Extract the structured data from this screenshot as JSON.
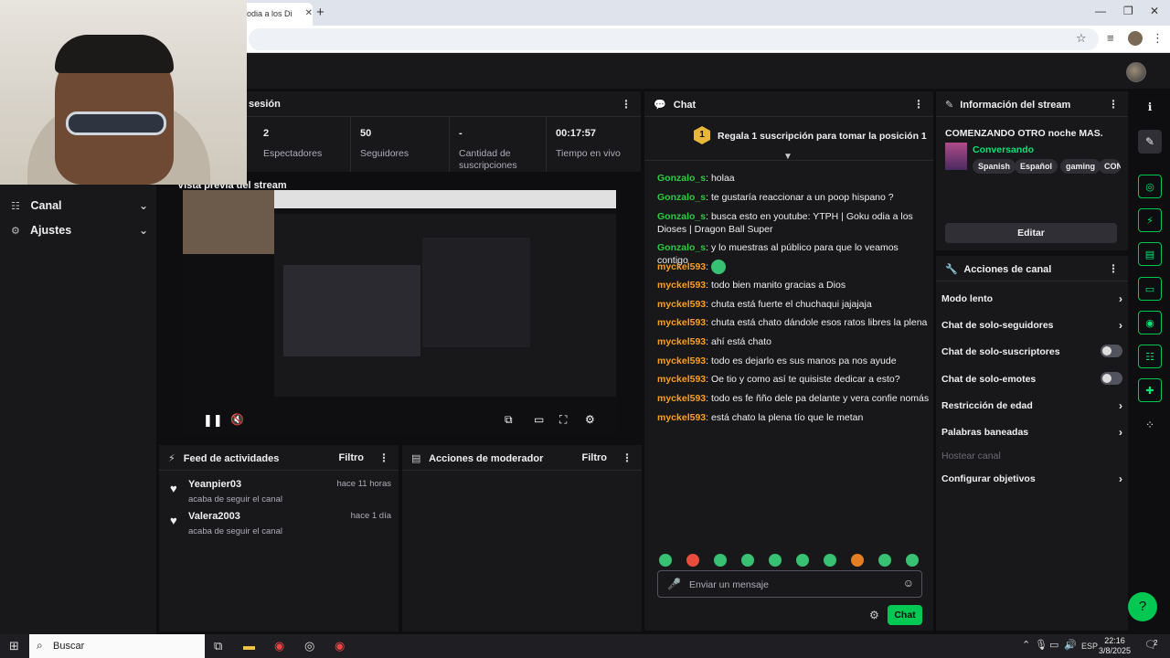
{
  "browser": {
    "tab_title": "odia a los Di",
    "new_tab": "+",
    "win_min": "—",
    "win_max": "❐",
    "win_close": "✕"
  },
  "sidebar": {
    "items": [
      {
        "label": "Canal"
      },
      {
        "label": "Ajustes"
      }
    ]
  },
  "session": {
    "title": "sesión",
    "stats": [
      {
        "value": "2",
        "label": "Espectadores"
      },
      {
        "value": "50",
        "label": "Seguidores"
      },
      {
        "value": "-",
        "label": "Cantidad de suscripciones"
      },
      {
        "value": "00:17:57",
        "label": "Tiempo en vivo"
      }
    ]
  },
  "preview": {
    "title": "Vista previa del stream"
  },
  "activity": {
    "title": "Feed de actividades",
    "filter": "Filtro",
    "items": [
      {
        "name": "Yeanpier03",
        "sub": "acaba de seguir el canal",
        "time": "hace 11 horas"
      },
      {
        "name": "Valera2003",
        "sub": "acaba de seguir el canal",
        "time": "hace 1 día"
      }
    ]
  },
  "modactions": {
    "title": "Acciones de moderador",
    "filter": "Filtro"
  },
  "chat": {
    "title": "Chat",
    "promo_badge": "1",
    "promo_text": "Regala 1 suscripción para tomar la posición 1",
    "messages": [
      {
        "user": "Gonzalo_s",
        "color": "#2ecc40",
        "text": "holaa"
      },
      {
        "user": "Gonzalo_s",
        "color": "#2ecc40",
        "text": "te gustaría reaccionar a un poop hispano ?"
      },
      {
        "user": "Gonzalo_s",
        "color": "#2ecc40",
        "text": "busca esto en youtube: YTPH | Goku odia a los Dioses | Dragon Ball Super"
      },
      {
        "user": "Gonzalo_s",
        "color": "#2ecc40",
        "text": "y lo muestras al público para que lo veamos contigo"
      },
      {
        "user": "myckel593",
        "color": "#ff9f1a",
        "text": ""
      },
      {
        "user": "myckel593",
        "color": "#ff9f1a",
        "text": "todo bien manito gracias a Dios"
      },
      {
        "user": "myckel593",
        "color": "#ff9f1a",
        "text": "chuta está fuerte el chuchaqui jajajaja"
      },
      {
        "user": "myckel593",
        "color": "#ff9f1a",
        "text": "chuta está chato dándole esos ratos libres la plena"
      },
      {
        "user": "myckel593",
        "color": "#ff9f1a",
        "text": "ahí está chato"
      },
      {
        "user": "myckel593",
        "color": "#ff9f1a",
        "text": "todo es dejarlo es sus manos pa nos ayude"
      },
      {
        "user": "myckel593",
        "color": "#ff9f1a",
        "text": "Oe tio y como así te quisiste dedicar a esto?"
      },
      {
        "user": "myckel593",
        "color": "#ff9f1a",
        "text": "todo es fe ñño dele pa delante y vera confie nomás"
      },
      {
        "user": "myckel593",
        "color": "#ff9f1a",
        "text": "está chato la plena tío que le metan"
      }
    ],
    "input_placeholder": "Enviar un mensaje",
    "send_label": "Chat"
  },
  "stream_info": {
    "title": "Información del stream",
    "stream_title": "COMENZANDO OTRO noche MAS.",
    "category": "Conversando",
    "tags": [
      "Spanish",
      "Español",
      "gaming",
      "CON"
    ],
    "edit_label": "Editar"
  },
  "channel_actions": {
    "title": "Acciones de canal",
    "items": [
      {
        "label": "Modo lento"
      },
      {
        "label": "Chat de solo-seguidores"
      },
      {
        "label": "Chat de solo-suscriptores"
      },
      {
        "label": "Chat de solo-emotes"
      },
      {
        "label": "Restricción de edad"
      },
      {
        "label": "Palabras baneadas"
      },
      {
        "label": "Hostear canal"
      },
      {
        "label": "Configurar objetivos"
      }
    ]
  },
  "taskbar": {
    "search_label": "Buscar",
    "lang": "ESP",
    "time": "22:16",
    "date": "3/8/2025",
    "notif_count": "2"
  },
  "colors": {
    "accent": "#00c853",
    "user_green": "#2ecc40",
    "user_orange": "#ff9f1a"
  }
}
